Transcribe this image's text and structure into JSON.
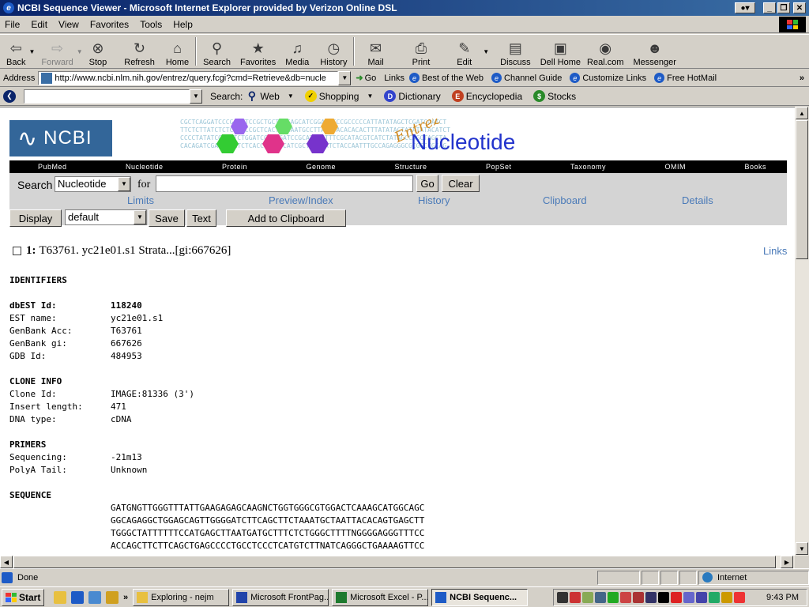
{
  "window": {
    "title": "NCBI Sequence Viewer - Microsoft Internet Explorer provided by Verizon Online DSL"
  },
  "menu": [
    "File",
    "Edit",
    "View",
    "Favorites",
    "Tools",
    "Help"
  ],
  "toolbar": {
    "back": "Back",
    "forward": "Forward",
    "stop": "Stop",
    "refresh": "Refresh",
    "home": "Home",
    "search": "Search",
    "favorites": "Favorites",
    "media": "Media",
    "history": "History",
    "mail": "Mail",
    "print": "Print",
    "edit": "Edit",
    "discuss": "Discuss",
    "dell_home": "Dell Home",
    "realcom": "Real.com",
    "messenger": "Messenger"
  },
  "address": {
    "label": "Address",
    "url": "http://www.ncbi.nlm.nih.gov/entrez/query.fcgi?cmd=Retrieve&db=nucle",
    "go": "Go",
    "links_label": "Links",
    "links": [
      "Best of the Web",
      "Channel Guide",
      "Customize Links",
      "Free HotMail"
    ]
  },
  "searchbar": {
    "label": "Search:",
    "items": [
      "Web",
      "Shopping",
      "Dictionary",
      "Encyclopedia",
      "Stocks"
    ]
  },
  "ncbi": {
    "logo": "NCBI",
    "banner_entrez": "Entrez",
    "banner_title": "Nucleotide",
    "banner_seq": [
      "CGCTCAGGATCCCGACTTCCGCTGCTCAGAGCATCGGATCCCCGCCCCCATTATATAGCTCGATCGATCT",
      "TTCTCTTATCTCTCTATCCGCTCACTCCCAATGCCTTATATACACACACTTTATATACTATATATACATCT",
      "CCCCTATATCGCTCTCTGGATCGCTGGATCCGCATAGGTTTCGCATACGTCATCTATAGCCAGCTAGCTA",
      "CACAGATCGATTCGATCTCACCCTTCTCATCGCTTTATATCTACCAATTTGCCAGAGGGCGCGGCCGCAG"
    ],
    "nav": [
      "PubMed",
      "Nucleotide",
      "Protein",
      "Genome",
      "Structure",
      "PopSet",
      "Taxonomy",
      "OMIM",
      "Books"
    ],
    "search_label": "Search",
    "db_selected": "Nucleotide",
    "for_label": "for",
    "query_value": "",
    "go_button": "Go",
    "clear_button": "Clear",
    "tabs": [
      "Limits",
      "Preview/Index",
      "History",
      "Clipboard",
      "Details"
    ],
    "display_button": "Display",
    "format_selected": "default",
    "save_button": "Save",
    "text_button": "Text",
    "clipboard_button": "Add to Clipboard"
  },
  "record": {
    "number": "1:",
    "title": "T63761. yc21e01.s1 Strata...[gi:667626]",
    "links": "Links",
    "identifiers_h": "IDENTIFIERS",
    "dbest_label": "dbEST Id:",
    "dbest_value": "118240",
    "est_label": "EST name:",
    "est_value": "yc21e01.s1",
    "acc_label": "GenBank Acc:",
    "acc_value": "T63761",
    "gi_label": "GenBank gi:",
    "gi_value": "667626",
    "gdb_label": "GDB Id:",
    "gdb_value": "484953",
    "clone_h": "CLONE INFO",
    "clone_label": "Clone Id:",
    "clone_value": "IMAGE:81336 (3')",
    "insert_label": "Insert length:",
    "insert_value": "471",
    "dna_label": "DNA type:",
    "dna_value": "cDNA",
    "primers_h": "PRIMERS",
    "seqp_label": "Sequencing:",
    "seqp_value": "-21m13",
    "polya_label": "PolyA Tail:",
    "polya_value": "Unknown",
    "sequence_h": "SEQUENCE",
    "sequence": [
      "GATGNGTTGGGTTTATTGAAGAGAGCAAGNCTGGTGGGCGTGGACTCAAAGCATGGCAGC",
      "GGCAGAGGCTGGAGCAGTTGGGGATCTTCAGCTTCTAAATGCTAATTACACAGTGAGCTT",
      "TGGGCTATTTTTTCCATGAGCTTAATGATGCTTTCTCTGGGCTTTTNGGGGAGGGTTTCC",
      "ACCAGCTTCTTCAGCTGAGCCCCTGCCTCCCTCATGTCTTNATCAGGGCTGAAAAGTTCC"
    ]
  },
  "status": {
    "text": "Done",
    "zone": "Internet"
  },
  "taskbar": {
    "start": "Start",
    "tasks": [
      "Exploring - nejm",
      "Microsoft FrontPag...",
      "Microsoft Excel - P...",
      "NCBI Sequenc..."
    ],
    "clock": "9:43 PM"
  },
  "colors": {
    "titlebar": "#0a246a",
    "ncbi_blue": "#336699",
    "link_blue": "#4a7ab8",
    "nucleotide_blue": "#2233cc"
  }
}
